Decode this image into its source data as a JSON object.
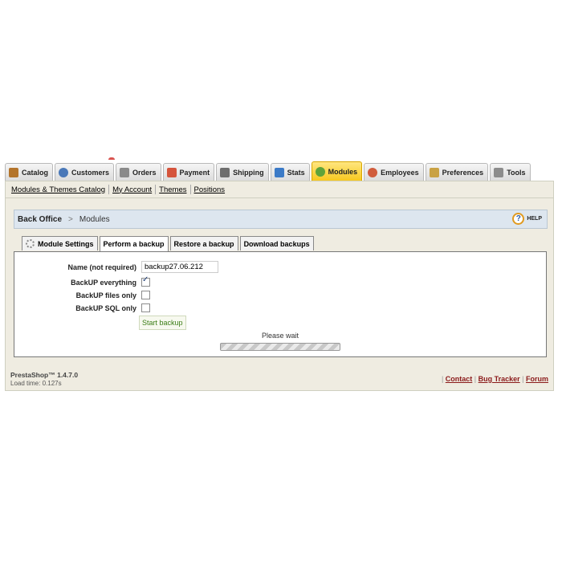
{
  "top_tabs": [
    {
      "label": "Catalog",
      "icon": "catalog-icon"
    },
    {
      "label": "Customers",
      "icon": "customers-icon"
    },
    {
      "label": "Orders",
      "icon": "orders-icon"
    },
    {
      "label": "Payment",
      "icon": "payment-icon"
    },
    {
      "label": "Shipping",
      "icon": "shipping-icon"
    },
    {
      "label": "Stats",
      "icon": "stats-icon"
    },
    {
      "label": "Modules",
      "icon": "modules-icon",
      "active": true
    },
    {
      "label": "Employees",
      "icon": "employees-icon"
    },
    {
      "label": "Preferences",
      "icon": "preferences-icon"
    },
    {
      "label": "Tools",
      "icon": "tools-icon"
    }
  ],
  "subnav": [
    "Modules & Themes Catalog",
    "My Account",
    "Themes",
    "Positions"
  ],
  "breadcrumb": {
    "root": "Back Office",
    "separator": ">",
    "current": "Modules"
  },
  "help_label": "HELP",
  "form_tabs": [
    "Module Settings",
    "Perform a backup",
    "Restore a backup",
    "Download backups"
  ],
  "form": {
    "name_label": "Name (not required)",
    "name_value": "backup27.06.212",
    "everything_label": "BackUP everything",
    "everything_checked": true,
    "files_label": "BackUP files only",
    "files_checked": false,
    "sql_label": "BackUP SQL only",
    "sql_checked": false,
    "start_button": "Start backup",
    "wait_text": "Please wait"
  },
  "footer": {
    "version": "PrestaShop™ 1.4.7.0",
    "load_time": "Load time: 0.127s",
    "links": [
      "Contact",
      "Bug Tracker",
      "Forum"
    ]
  },
  "colors": {
    "active_tab": "#f7c81f",
    "panel_bg": "#efece1",
    "breadcrumb_bg": "#dde6ef",
    "link_color": "#8b1a1a",
    "button_text": "#3a7d16"
  }
}
